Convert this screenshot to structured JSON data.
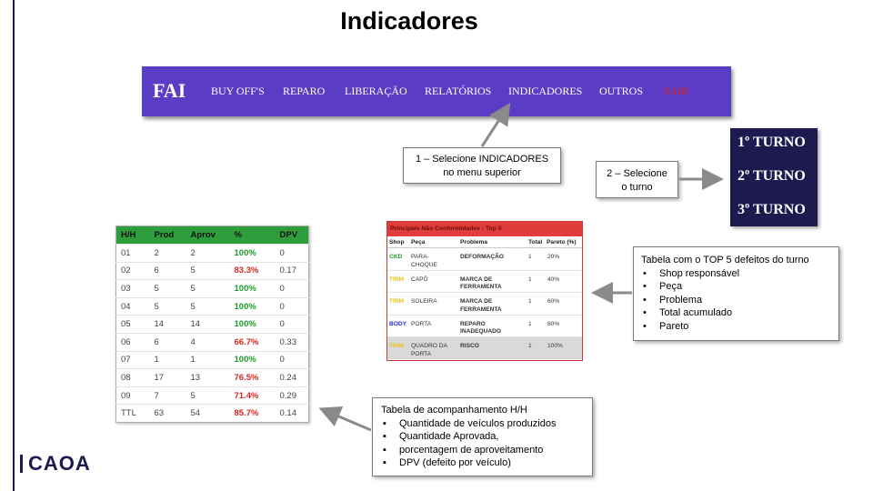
{
  "title": "Indicadores",
  "navbar": {
    "brand": "FAI",
    "items": [
      "BUY OFF'S",
      "REPARO",
      "LIBERAÇÃO",
      "RELATÓRIOS",
      "INDICADORES",
      "OUTROS",
      "SAIR"
    ],
    "exit_color": "#e02020"
  },
  "callouts": {
    "step1": [
      "1 – Selecione INDICADORES",
      "no menu superior"
    ],
    "step2": [
      "2 – Selecione",
      "o turno"
    ],
    "top5": {
      "heading": "Tabela com o TOP 5 defeitos do turno",
      "items": [
        "Shop responsável",
        "Peça",
        "Problema",
        "Total acumulado",
        "Pareto"
      ]
    },
    "hh": {
      "heading": "Tabela de acompanhamento H/H",
      "items": [
        "Quantidade de veículos produzidos",
        "Quantidade Aprovada,",
        "porcentagem de aproveitamento",
        "DPV (defeito por veículo)"
      ]
    }
  },
  "turnos": [
    "1º TURNO",
    "2º TURNO",
    "3º TURNO"
  ],
  "hh_table": {
    "headers": [
      "H/H",
      "Prod",
      "Aprov",
      "%",
      "DPV"
    ],
    "rows": [
      [
        "01",
        "2",
        "2",
        "100%",
        "0"
      ],
      [
        "02",
        "6",
        "5",
        "83.3%",
        "0.17"
      ],
      [
        "03",
        "5",
        "5",
        "100%",
        "0"
      ],
      [
        "04",
        "5",
        "5",
        "100%",
        "0"
      ],
      [
        "05",
        "14",
        "14",
        "100%",
        "0"
      ],
      [
        "06",
        "6",
        "4",
        "66.7%",
        "0.33"
      ],
      [
        "07",
        "1",
        "1",
        "100%",
        "0"
      ],
      [
        "08",
        "17",
        "13",
        "76.5%",
        "0.24"
      ],
      [
        "09",
        "7",
        "5",
        "71.4%",
        "0.29"
      ],
      [
        "TTL",
        "63",
        "54",
        "85.7%",
        "0.14"
      ]
    ]
  },
  "top5_table": {
    "title": "Principais Não Conformidades - Top 5",
    "headers": [
      "Shop",
      "Peça",
      "Problema",
      "Total",
      "Pareto (%)"
    ],
    "rows": [
      {
        "shop": "CKD",
        "shop_color": "#1f9a2b",
        "peca": [
          "PARA-",
          "CHOQUE"
        ],
        "problema": [
          "DEFORMAÇÃO"
        ],
        "total": "1",
        "pareto": "20%"
      },
      {
        "shop": "TRIM",
        "shop_color": "#e8c21a",
        "peca": [
          "CAPÔ"
        ],
        "problema": [
          "MARCA DE",
          "FERRAMENTA"
        ],
        "total": "1",
        "pareto": "40%"
      },
      {
        "shop": "TRIM",
        "shop_color": "#e8c21a",
        "peca": [
          "SOLEIRA"
        ],
        "problema": [
          "MARCA DE",
          "FERRAMENTA"
        ],
        "total": "1",
        "pareto": "60%"
      },
      {
        "shop": "BODY",
        "shop_color": "#2b2bd6",
        "peca": [
          "PORTA"
        ],
        "problema": [
          "REPARO",
          "INADEQUADO"
        ],
        "total": "1",
        "pareto": "80%"
      },
      {
        "shop": "TRIM",
        "shop_color": "#e8c21a",
        "peca": [
          "QUADRO DA",
          "PORTA"
        ],
        "problema": [
          "RISCO"
        ],
        "total": "1",
        "pareto": "100%"
      }
    ]
  },
  "logo": "CAOA",
  "colors": {
    "nav": "#5b3cc4",
    "turno_panel": "#1c1a4e",
    "hh_header": "#2e9e3c",
    "top5_header": "#e03c3c"
  }
}
